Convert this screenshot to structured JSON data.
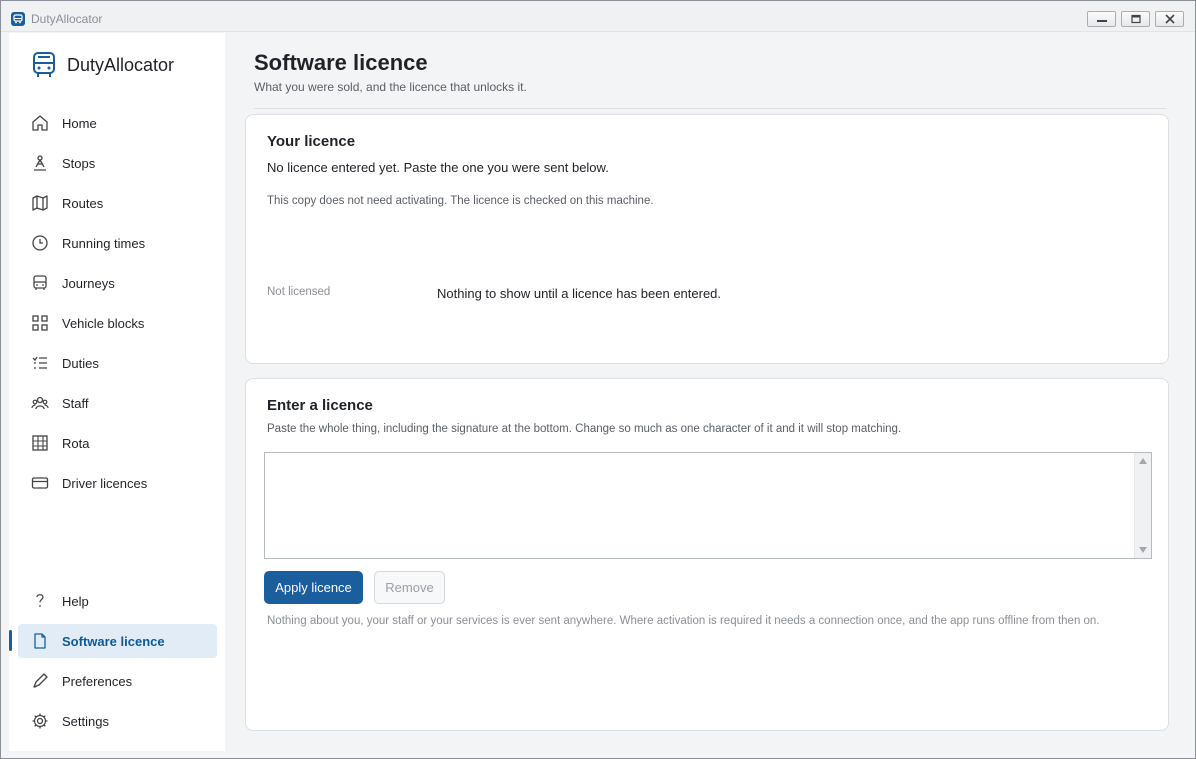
{
  "window": {
    "title": "DutyAllocator"
  },
  "sidebar": {
    "brand": "DutyAllocator",
    "items": [
      {
        "label": "Home",
        "icon": "home-icon"
      },
      {
        "label": "Stops",
        "icon": "stop-icon"
      },
      {
        "label": "Routes",
        "icon": "map-icon"
      },
      {
        "label": "Running times",
        "icon": "clock-icon"
      },
      {
        "label": "Journeys",
        "icon": "bus-icon"
      },
      {
        "label": "Vehicle blocks",
        "icon": "grid-icon"
      },
      {
        "label": "Duties",
        "icon": "list-icon"
      },
      {
        "label": "Staff",
        "icon": "people-icon"
      },
      {
        "label": "Rota",
        "icon": "table-icon"
      },
      {
        "label": "Driver licences",
        "icon": "card-icon"
      }
    ],
    "bottom_items": [
      {
        "label": "Help",
        "icon": "help-icon"
      },
      {
        "label": "Software licence",
        "icon": "document-icon",
        "active": true
      },
      {
        "label": "Preferences",
        "icon": "pen-icon"
      },
      {
        "label": "Settings",
        "icon": "gear-icon"
      }
    ]
  },
  "page": {
    "title": "Software licence",
    "subtitle": "What you were sold, and the licence that unlocks it."
  },
  "your_licence": {
    "title": "Your licence",
    "status": "No licence entered yet. Paste the one you were sent below.",
    "note": "This copy does not need activating. The licence is checked on this machine.",
    "state_label": "Not licensed",
    "state_detail": "Nothing to show until a licence has been entered."
  },
  "enter_licence": {
    "title": "Enter a licence",
    "hint": "Paste the whole thing, including the signature at the bottom. Change so much as one character of it and it will stop matching.",
    "input_value": "",
    "apply_label": "Apply licence",
    "remove_label": "Remove",
    "privacy_note": "Nothing about you, your staff or your services is ever sent anywhere. Where activation is required it needs a connection once, and the app runs offline from then on."
  },
  "colors": {
    "accent": "#1a5e9e",
    "active_bg": "#e2ecf6",
    "page_bg": "#f3f4f6"
  }
}
